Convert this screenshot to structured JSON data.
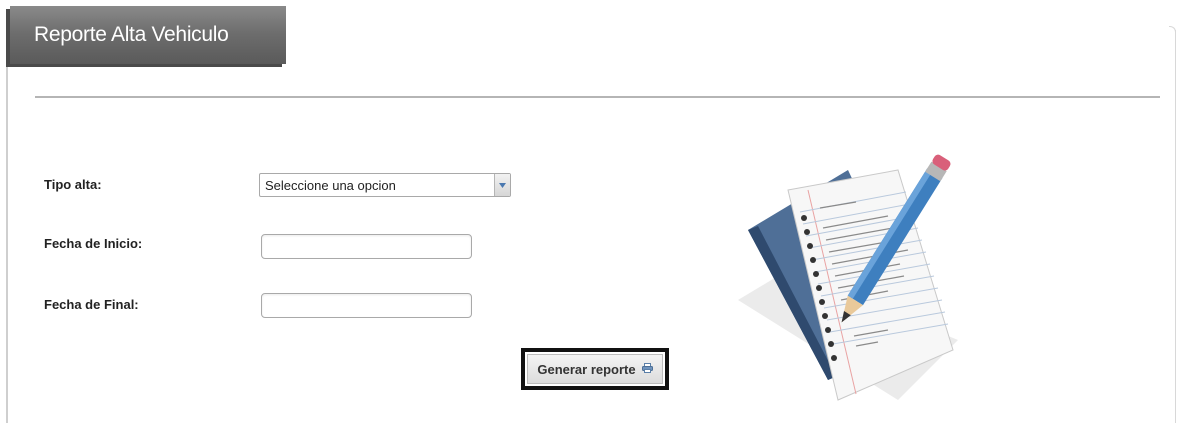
{
  "header": {
    "title": "Reporte Alta Vehiculo"
  },
  "form": {
    "tipo_alta": {
      "label": "Tipo alta:",
      "selected": "Seleccione una opcion"
    },
    "fecha_inicio": {
      "label": "Fecha de Inicio:",
      "value": ""
    },
    "fecha_final": {
      "label": "Fecha de Final:",
      "value": ""
    },
    "generate_button": {
      "label": "Generar reporte",
      "icon": "printer-icon"
    }
  },
  "illustration": {
    "icon": "notepad-pencil-icon"
  },
  "colors": {
    "header_bg": "#6e6e6e",
    "header_text": "#ffffff",
    "divider": "#b5b5b5",
    "button_focus_border": "#111111"
  }
}
